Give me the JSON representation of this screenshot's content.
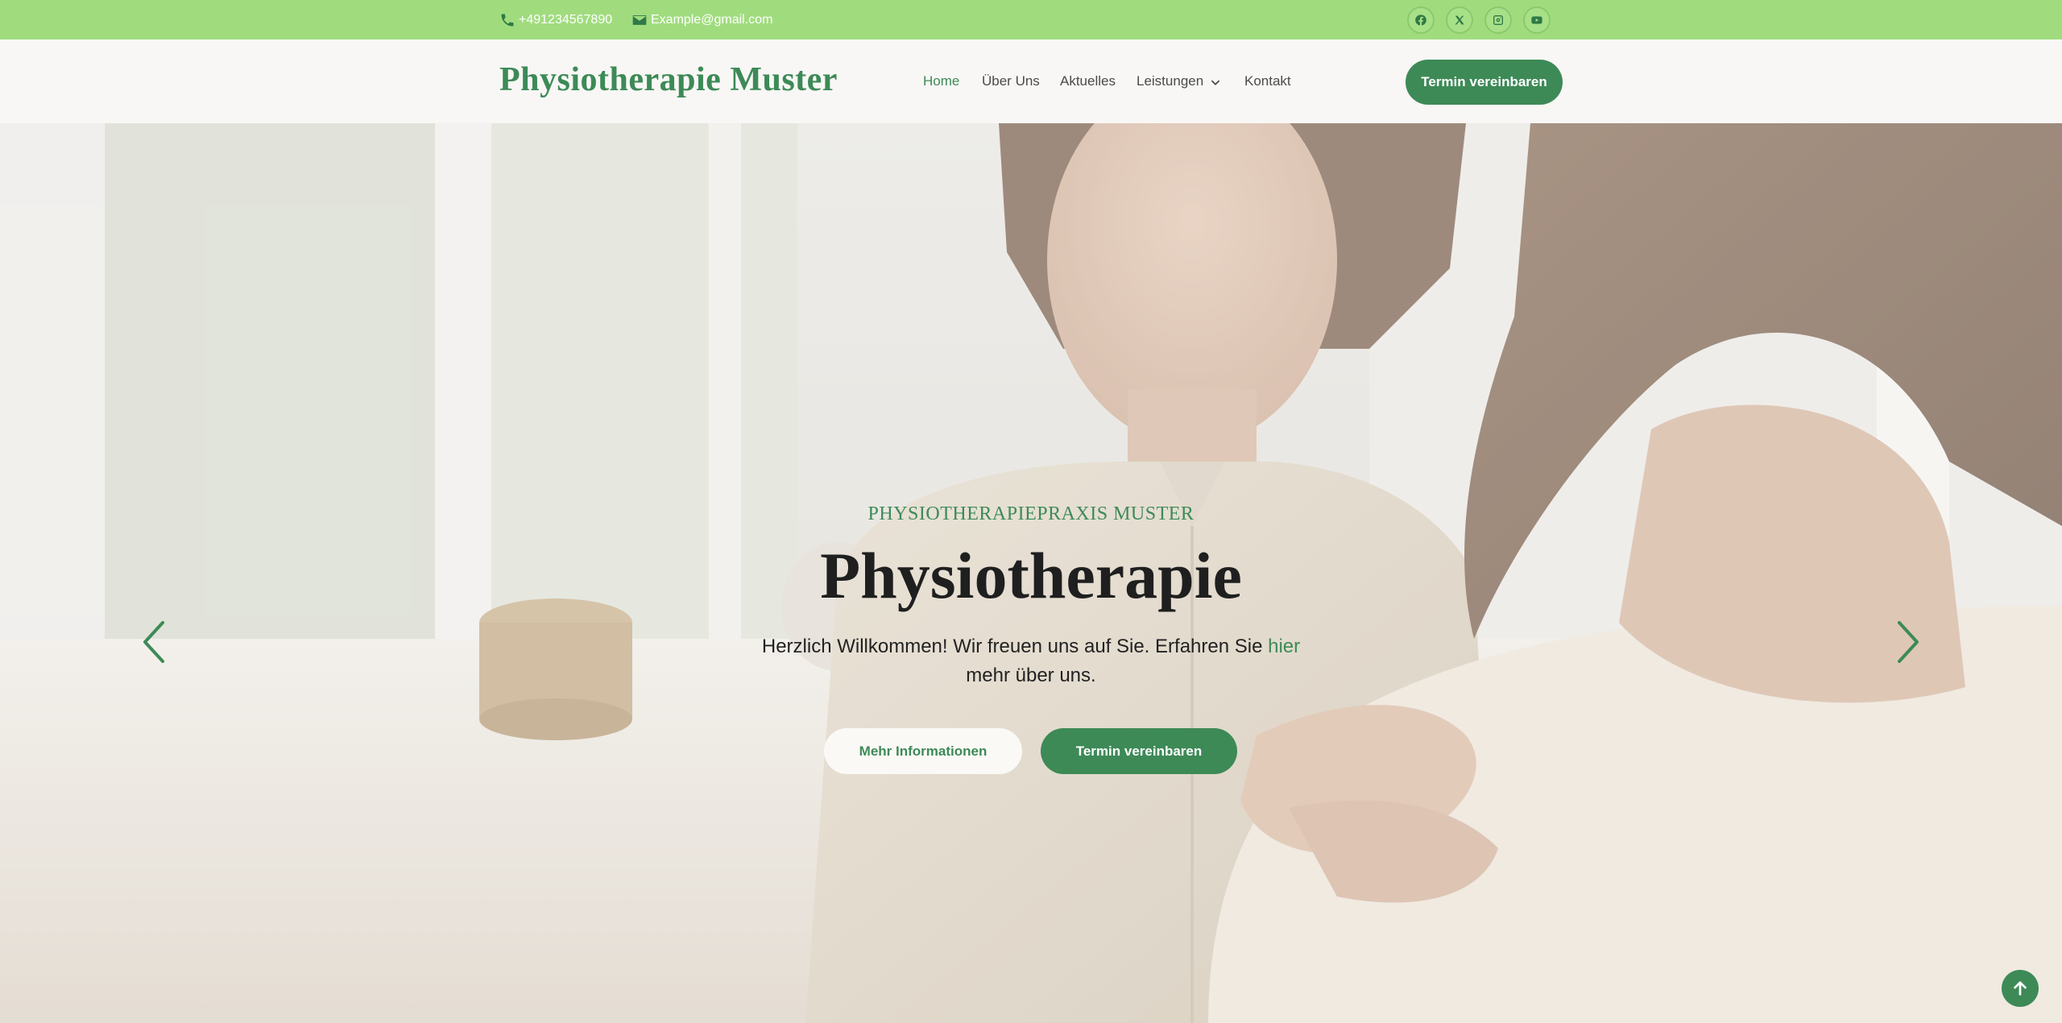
{
  "topbar": {
    "phone": "+491234567890",
    "email": "Example@gmail.com",
    "social": [
      "facebook-icon",
      "x-icon",
      "instagram-icon",
      "youtube-icon"
    ]
  },
  "header": {
    "logo": "Physiotherapie Muster",
    "nav": [
      {
        "label": "Home",
        "active": true
      },
      {
        "label": "Über Uns"
      },
      {
        "label": "Aktuelles"
      },
      {
        "label": "Leistungen",
        "dropdown": true
      },
      {
        "label": "Kontakt"
      }
    ],
    "cta": "Termin vereinbaren"
  },
  "hero": {
    "kicker": "PHYSIOTHERAPIEPRAXIS MUSTER",
    "title": "Physiotherapie",
    "text_before": "Herzlich Willkommen! Wir freuen uns auf Sie. Erfahren Sie ",
    "text_link": "hier",
    "text_after": " mehr über uns.",
    "btn_more": "Mehr Informationen",
    "btn_appointment": "Termin vereinbaren"
  },
  "colors": {
    "topbar": "#a0dc7e",
    "accent": "#3d8a57",
    "header_bg": "#f8f7f5"
  },
  "icons": [
    "phone-icon",
    "mail-icon",
    "chevron-down-icon",
    "arrow-left-icon",
    "arrow-right-icon",
    "arrow-up-icon"
  ]
}
